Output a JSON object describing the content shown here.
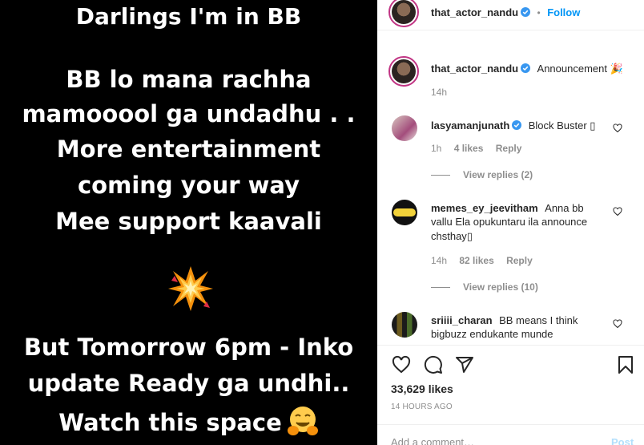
{
  "media": {
    "lines": [
      "Darlings I'm in BB",
      "BB lo mana rachha",
      "mamooool ga undadhu . .",
      "More entertainment",
      "coming your way",
      "Mee  support kaavali",
      "But Tomorrow 6pm -  Inko",
      "update Ready ga undhi..",
      "Watch this space"
    ],
    "burst_emoji": "collision-emoji",
    "hug_emoji": "hugging-face-emoji"
  },
  "header": {
    "username": "that_actor_nandu",
    "separator": "•",
    "follow_label": "Follow"
  },
  "caption": {
    "username": "that_actor_nandu",
    "text": "Announcement 🎉",
    "time": "14h"
  },
  "comments": [
    {
      "username": "lasyamanjunath",
      "verified": true,
      "text": "Block Buster ▯",
      "time": "1h",
      "likes": "4 likes",
      "reply": "Reply",
      "view_replies": "View replies (2)"
    },
    {
      "username": "memes_ey_jeevitham",
      "verified": false,
      "text_line1": "Anna bb",
      "text_line2": "vallu Ela opukuntaru ila announce",
      "text_line3": "chsthay▯",
      "time": "14h",
      "likes": "82 likes",
      "reply": "Reply",
      "view_replies": "View replies (10)"
    },
    {
      "username": "sriiii_charan",
      "verified": false,
      "text_line1": "BB means I think",
      "text_line2": "bigbuzz endukante munde"
    }
  ],
  "actions": {
    "like_icon": "heart-icon",
    "comment_icon": "comment-icon",
    "share_icon": "paper-plane-icon",
    "save_icon": "bookmark-icon"
  },
  "stats": {
    "likes": "33,629 likes",
    "time_ago": "14 HOURS AGO"
  },
  "composer": {
    "placeholder": "Add a comment…",
    "post_label": "Post"
  },
  "colors": {
    "follow": "#0095f6",
    "verified": "#3897f0",
    "secondary_text": "#8e8e8e",
    "post_disabled": "#b2dffc"
  }
}
